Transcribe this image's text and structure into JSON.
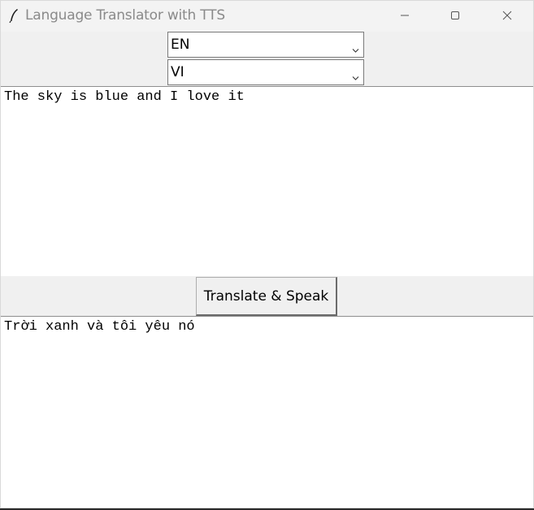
{
  "window": {
    "title": "Language Translator with TTS",
    "icon": "feather-icon",
    "controls": {
      "minimize": "minimize-icon",
      "maximize": "maximize-icon",
      "close": "close-icon"
    }
  },
  "source_language": {
    "value": "EN"
  },
  "target_language": {
    "value": "VI"
  },
  "input_text": "The sky is blue and I love it",
  "action_button": {
    "label": "Translate & Speak"
  },
  "output_text": "Trời xanh và tôi yêu nó",
  "colors": {
    "window_bg": "#f0f0f0",
    "title_text": "#8a8a8a",
    "textarea_bg": "#ffffff"
  }
}
